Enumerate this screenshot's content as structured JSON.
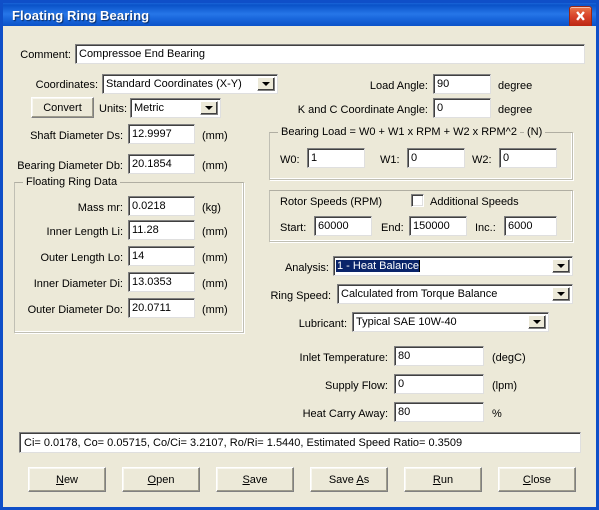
{
  "window": {
    "title": "Floating Ring Bearing",
    "close_icon": "close-icon"
  },
  "comment": {
    "label": "Comment:",
    "value": "Compressoe End Bearing"
  },
  "coordinates": {
    "label": "Coordinates:",
    "value": "Standard Coordinates (X-Y)"
  },
  "convert": {
    "label": "Convert"
  },
  "units": {
    "label": "Units:",
    "value": "Metric"
  },
  "load_angle": {
    "label": "Load Angle:",
    "value": "90",
    "unit": "degree"
  },
  "kc_angle": {
    "label": "K and C Coordinate Angle:",
    "value": "0",
    "unit": "degree"
  },
  "shaft_diameter": {
    "label": "Shaft Diameter Ds:",
    "value": "12.9997",
    "unit": "(mm)"
  },
  "bearing_diameter": {
    "label": "Bearing Diameter Db:",
    "value": "20.1854",
    "unit": "(mm)"
  },
  "floating_ring": {
    "group_title": "Floating Ring Data",
    "fields": [
      {
        "label": "Mass mr:",
        "value": "0.0218",
        "unit": "(kg)"
      },
      {
        "label": "Inner Length Li:",
        "value": "11.28",
        "unit": "(mm)"
      },
      {
        "label": "Outer Length Lo:",
        "value": "14",
        "unit": "(mm)"
      },
      {
        "label": "Inner Diameter Di:",
        "value": "13.0353",
        "unit": "(mm)"
      },
      {
        "label": "Outer Diameter Do:",
        "value": "20.0711",
        "unit": "(mm)"
      }
    ]
  },
  "bearing_load": {
    "group_title": "Bearing Load = W0 + W1 x RPM + W2 x RPM^2",
    "group_unit": "(N)",
    "fields": [
      {
        "label": "W0:",
        "value": "1"
      },
      {
        "label": "W1:",
        "value": "0"
      },
      {
        "label": "W2:",
        "value": "0"
      }
    ]
  },
  "rotor_speeds": {
    "title": "Rotor Speeds (RPM)",
    "additional_speeds_label": "Additional Speeds",
    "additional_speeds_checked": false,
    "fields": [
      {
        "label": "Start:",
        "value": "60000"
      },
      {
        "label": "End:",
        "value": "150000"
      },
      {
        "label": "Inc.:",
        "value": "6000"
      }
    ]
  },
  "analysis": {
    "label": "Analysis:",
    "value": "1 - Heat Balance",
    "focused": true
  },
  "ring_speed": {
    "label": "Ring Speed:",
    "value": "Calculated from Torque Balance"
  },
  "lubricant": {
    "label": "Lubricant:",
    "value": "Typical SAE 10W-40"
  },
  "inlet_temperature": {
    "label": "Inlet Temperature:",
    "value": "80",
    "unit": "(degC)"
  },
  "supply_flow": {
    "label": "Supply Flow:",
    "value": "0",
    "unit": "(lpm)"
  },
  "heat_carry_away": {
    "label": "Heat Carry Away:",
    "value": "80",
    "unit": "%"
  },
  "status": {
    "text": "Ci= 0.0178, Co= 0.05715, Co/Ci= 3.2107, Ro/Ri= 1.5440, Estimated Speed Ratio= 0.3509"
  },
  "buttons": {
    "new": {
      "accel": "N",
      "rest": "ew"
    },
    "open": {
      "accel": "O",
      "rest": "pen"
    },
    "save": {
      "accel": "S",
      "rest": "ave"
    },
    "save_as_pre": "Save ",
    "save_as_accel": "A",
    "save_as_rest": "s",
    "run": {
      "accel": "R",
      "rest": "un"
    },
    "close": {
      "accel": "C",
      "rest": "lose"
    }
  },
  "colors": {
    "dialog_face": "#ece9d8",
    "title_blue": "#0a52c8",
    "selection_blue": "#0a246a",
    "close_red": "#d9452b"
  }
}
